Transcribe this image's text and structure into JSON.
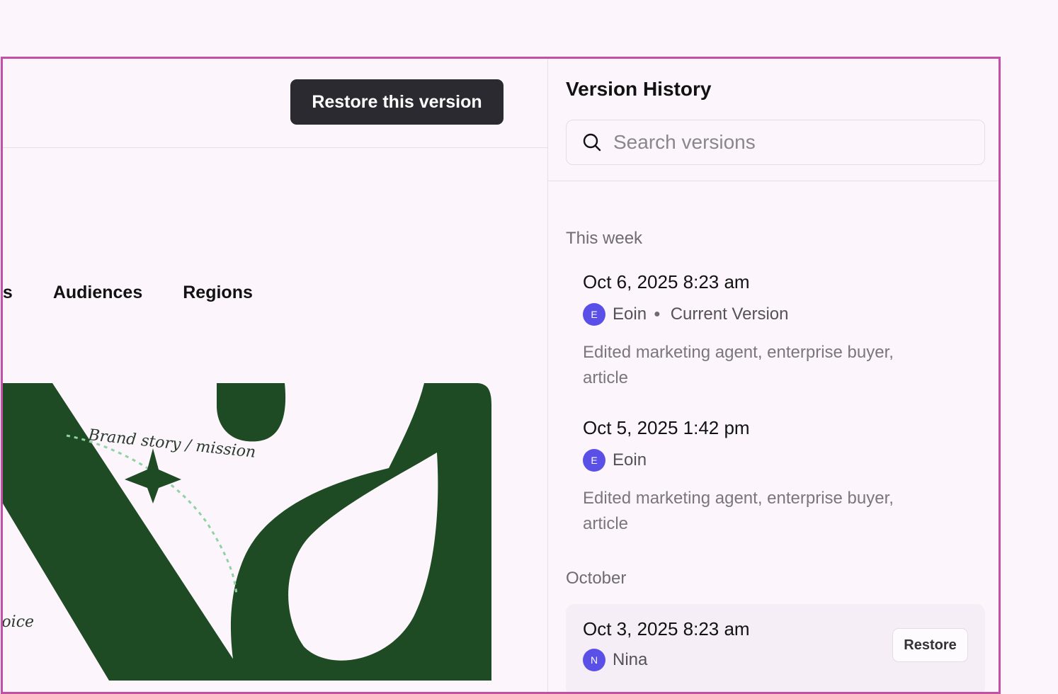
{
  "toolbar": {
    "restore_label": "Restore this version"
  },
  "tabs": [
    "es",
    "Audiences",
    "Regions"
  ],
  "hero": {
    "annotation_1": "Brand story / mission",
    "annotation_2": "voice",
    "ink_color": "#1e4a24",
    "dash_color": "#8fd3a4"
  },
  "panel": {
    "title": "Version History",
    "search_placeholder": "Search versions",
    "groups": [
      {
        "label": "This week"
      },
      {
        "label": "October"
      }
    ],
    "entries": [
      {
        "date": "Oct 6, 2025 8:23 am",
        "author": "Eoin",
        "initial": "E",
        "badge": "Current Version",
        "description": "Edited marketing agent, enterprise buyer, article"
      },
      {
        "date": "Oct 5, 2025 1:42 pm",
        "author": "Eoin",
        "initial": "E",
        "description": "Edited marketing agent, enterprise buyer, article"
      },
      {
        "date": "Oct 3, 2025 8:23 am",
        "author": "Nina",
        "initial": "N",
        "restore_label": "Restore"
      }
    ]
  },
  "colors": {
    "frame": "#c44fa7",
    "primary_button": "#2b2a30",
    "avatar": "#5a50e8",
    "background": "#fdf5fc"
  }
}
